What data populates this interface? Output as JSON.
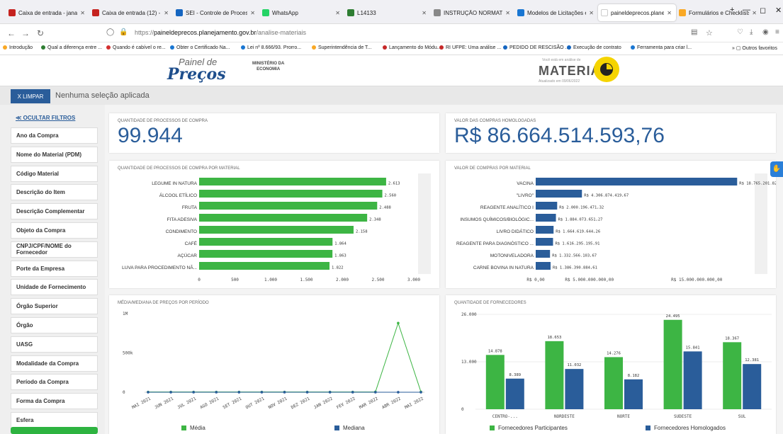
{
  "browser": {
    "tabs": [
      {
        "label": "Caixa de entrada - jana.l",
        "color": "#c5221f"
      },
      {
        "label": "Caixa de entrada (12) - a",
        "color": "#c5221f"
      },
      {
        "label": "SEI - Controle de Process",
        "color": "#1565c0"
      },
      {
        "label": "WhatsApp",
        "color": "#25d366"
      },
      {
        "label": "L14133",
        "color": "#2e7d32"
      },
      {
        "label": "INSTRUÇÃO NORMATIV",
        "color": "#888888"
      },
      {
        "label": "Modelos de Licitações e",
        "color": "#1976d2"
      },
      {
        "label": "paineldeprecos.planejament",
        "color": "#ffffff"
      },
      {
        "label": "Formulários e Checklists",
        "color": "#f9a825"
      }
    ],
    "url_prefix": "https://",
    "url_domain": "paineldeprecos.planejamento.gov.br",
    "url_path": "/analise-materiais",
    "bookmarks": [
      "Introdução",
      "Qual a diferença entre ...",
      "Quando é cabível o re...",
      "Obter o Certificado Na...",
      "Lei nº 8.666/93. Prorro...",
      "Superintendência de T...",
      "Lançamento do Módu...",
      "RI UFPE: Uma análise ...",
      "PEDIDO DE RESCISÃO ...",
      "Execução de contrato",
      "Ferramenta para criar l..."
    ],
    "other_bookmarks": "Outros favoritos"
  },
  "header": {
    "logo_top": "Painel de",
    "logo_main": "Preços",
    "ministry_line1": "MINISTÉRIO DA",
    "ministry_line2": "ECONOMIA",
    "section_hint": "Você está em análise de",
    "section_title": "MATERIAIS",
    "updated": "Atualizado em 09/06/2022"
  },
  "filters": {
    "clear_label": "X LIMPAR",
    "status": "Nenhuma seleção aplicada",
    "hide_label": "≪ OCULTAR FILTROS",
    "items": [
      "Ano da Compra",
      "Nome do Material (PDM)",
      "Código Material",
      "Descrição do Item",
      "Descrição Complementar",
      "Objeto da Compra",
      "CNPJ/CPF/NOME do Fornecedor",
      "Porte da Empresa",
      "Unidade de Fornecimento",
      "Órgão Superior",
      "Órgão",
      "UASG",
      "Modalidade da Compra",
      "Período da Compra",
      "Forma da Compra",
      "Esfera"
    ]
  },
  "kpis": {
    "processes_title": "QUANTIDADE DE PROCESSOS DE COMPRA",
    "processes_value": "99.944",
    "value_title": "VALOR DAS COMPRAS HOMOLOGADAS",
    "value_value": "R$ 86.664.514.593,76"
  },
  "chart_data": [
    {
      "type": "bar",
      "orientation": "horizontal",
      "title": "QUANTIDADE DE PROCESSOS DE COMPRA POR MATERIAL",
      "categories": [
        "LEGUME IN NATURA",
        "ÁLCOOL ETÍLICO",
        "FRUTA",
        "FITA ADESIVA",
        "CONDIMENTO",
        "CAFÉ",
        "AÇÚCAR",
        "LUVA PARA PROCEDIMENTO NÃ..."
      ],
      "values": [
        2613,
        2560,
        2488,
        2348,
        2158,
        1864,
        1863,
        1822
      ],
      "labels": [
        "2.613",
        "2.560",
        "2.488",
        "2.348",
        "2.158",
        "1.864",
        "1.863",
        "1.822"
      ],
      "xlim": [
        0,
        3000
      ],
      "ticks": [
        0,
        500,
        1000,
        1500,
        2000,
        2500,
        3000
      ],
      "tick_labels": [
        "0",
        "500",
        "1.000",
        "1.500",
        "2.000",
        "2.500",
        "3.000"
      ],
      "color": "#3db544"
    },
    {
      "type": "bar",
      "orientation": "horizontal",
      "title": "VALOR DE COMPRAS POR MATERIAL",
      "categories": [
        "VACINA",
        "\"LIVRO\"",
        "REAGENTE ANALÍTICO I",
        "INSUMOS QUÍMICOS/BIOLÓGIC...",
        "LIVRO DIDÁTICO",
        "REAGENTE PARA DIAGNÓSTICO ...",
        "MOTONIVELADORA",
        "CARNE BOVINA IN NATURA"
      ],
      "values": [
        18765201822.36,
        4306874419.67,
        2000196471.32,
        1884073651.27,
        1664619644.26,
        1616295195.91,
        1332566103.67,
        1386390884.61
      ],
      "labels": [
        "R$ 18.765.201.822,36",
        "R$ 4.306.874.419,67",
        "R$ 2.000.196.471,32",
        "R$ 1.884.073.651,27",
        "R$ 1.664.619.644,26",
        "R$ 1.616.295.195,91",
        "R$ 1.332.566.103,67",
        "R$ 1.386.390.884,61"
      ],
      "xlim": [
        0,
        20000000000
      ],
      "ticks": [
        0,
        5000000000,
        15000000000
      ],
      "tick_labels": [
        "R$ 0,00",
        "R$ 5.000.000.000,00",
        "R$ 15.000.000.000,00"
      ],
      "color": "#2a5d9a"
    },
    {
      "type": "line",
      "title": "MÉDIA/MEDIANA DE PREÇOS POR PERÍODO",
      "x": [
        "MAI 2021",
        "JUN 2021",
        "JUL 2021",
        "AGO 2021",
        "SET 2021",
        "OUT 2021",
        "NOV 2021",
        "DEZ 2021",
        "JAN 2022",
        "FEV 2022",
        "MAR 2022",
        "ABR 2022",
        "MAI 2022"
      ],
      "ylim": [
        0,
        1000000
      ],
      "y_ticks": [
        0,
        500000,
        1000000
      ],
      "y_tick_labels": [
        "0",
        "500k",
        "1M"
      ],
      "series": [
        {
          "name": "Média",
          "color": "#3db544",
          "values": [
            3000,
            3000,
            3000,
            3000,
            3000,
            3000,
            3000,
            3000,
            3000,
            3000,
            5000,
            880000,
            5000
          ]
        },
        {
          "name": "Mediana",
          "color": "#2a5d9a",
          "values": [
            500,
            500,
            500,
            500,
            500,
            500,
            500,
            500,
            500,
            500,
            500,
            500,
            500
          ]
        }
      ]
    },
    {
      "type": "bar",
      "title": "QUANTIDADE DE FORNECEDORES",
      "categories": [
        "CENTRO-...",
        "NORDESTE",
        "NORTE",
        "SUDESTE",
        "SUL"
      ],
      "ylim": [
        0,
        26000
      ],
      "y_ticks": [
        0,
        13000,
        26000
      ],
      "y_tick_labels": [
        "0",
        "13.000",
        "26.000"
      ],
      "series": [
        {
          "name": "Fornecedores Participantes",
          "color": "#3db544",
          "values": [
            14878,
            18653,
            14276,
            24495,
            18367
          ],
          "labels": [
            "14.878",
            "18.653",
            "14.276",
            "24.495",
            "18.367"
          ]
        },
        {
          "name": "Fornecedores Homologados",
          "color": "#2a5d9a",
          "values": [
            8389,
            11032,
            8182,
            15841,
            12381
          ],
          "labels": [
            "8.389",
            "11.032",
            "8.182",
            "15.841",
            "12.381"
          ]
        }
      ]
    }
  ]
}
